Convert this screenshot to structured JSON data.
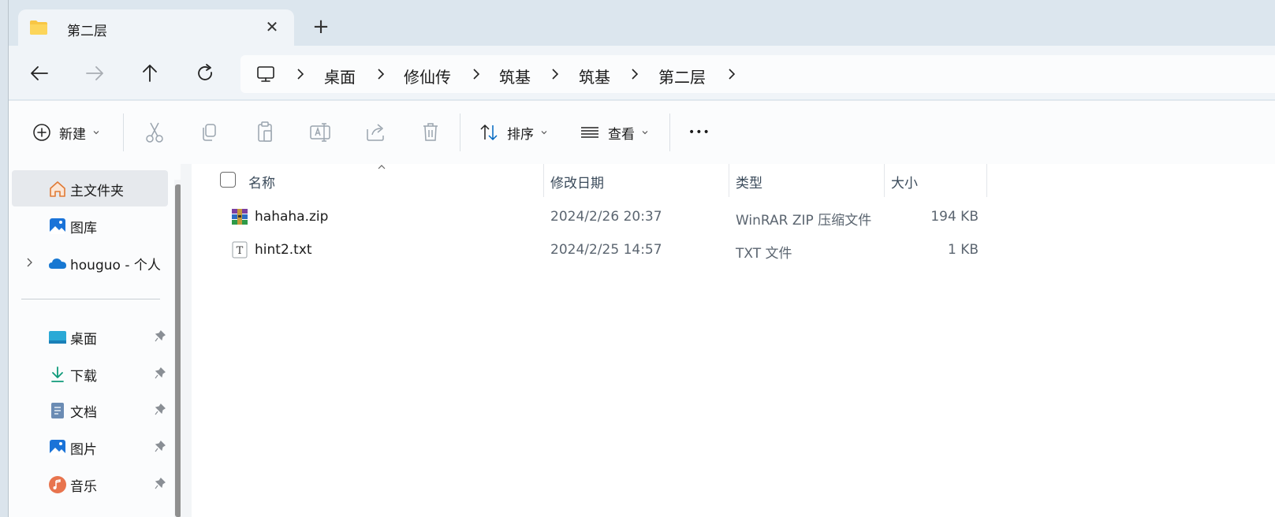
{
  "tab": {
    "title": "第二层",
    "close_glyph": "✕",
    "new_tab_glyph": "+"
  },
  "breadcrumb": [
    "桌面",
    "修仙传",
    "筑基",
    "筑基",
    "第二层"
  ],
  "toolbar": {
    "new_label": "新建",
    "sort_label": "排序",
    "view_label": "查看",
    "more_glyph": "•••"
  },
  "sidebar": {
    "home": "主文件夹",
    "gallery": "图库",
    "onedrive": "houguo - 个人",
    "pinned": [
      {
        "label": "桌面",
        "icon": "desktop-icon"
      },
      {
        "label": "下载",
        "icon": "download-icon"
      },
      {
        "label": "文档",
        "icon": "document-icon"
      },
      {
        "label": "图片",
        "icon": "pictures-icon"
      },
      {
        "label": "音乐",
        "icon": "music-icon"
      }
    ]
  },
  "columns": {
    "name": "名称",
    "modified": "修改日期",
    "type": "类型",
    "size": "大小"
  },
  "files": [
    {
      "name": "hahaha.zip",
      "modified": "2024/2/26 20:37",
      "type": "WinRAR ZIP 压缩文件",
      "size": "194 KB",
      "icon": "winrar-zip-icon"
    },
    {
      "name": "hint2.txt",
      "modified": "2024/2/25 14:57",
      "type": "TXT 文件",
      "size": "1 KB",
      "icon": "text-file-icon"
    }
  ],
  "colors": {
    "accent": "#0067c0",
    "folder": "#f8c645",
    "selected_bg": "#e6e9ed"
  }
}
